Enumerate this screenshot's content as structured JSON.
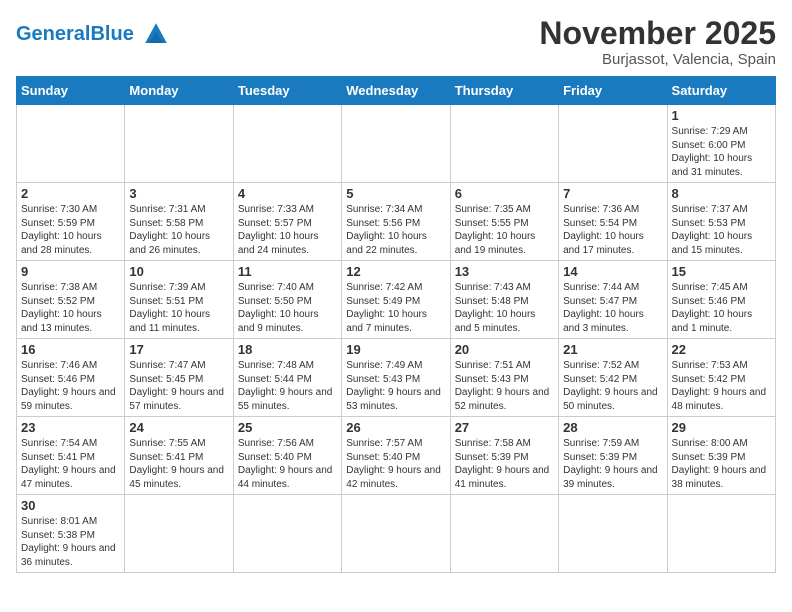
{
  "header": {
    "logo_general": "General",
    "logo_blue": "Blue",
    "month_title": "November 2025",
    "location": "Burjassot, Valencia, Spain"
  },
  "weekdays": [
    "Sunday",
    "Monday",
    "Tuesday",
    "Wednesday",
    "Thursday",
    "Friday",
    "Saturday"
  ],
  "weeks": [
    [
      {
        "day": "",
        "info": ""
      },
      {
        "day": "",
        "info": ""
      },
      {
        "day": "",
        "info": ""
      },
      {
        "day": "",
        "info": ""
      },
      {
        "day": "",
        "info": ""
      },
      {
        "day": "",
        "info": ""
      },
      {
        "day": "1",
        "info": "Sunrise: 7:29 AM\nSunset: 6:00 PM\nDaylight: 10 hours and 31 minutes."
      }
    ],
    [
      {
        "day": "2",
        "info": "Sunrise: 7:30 AM\nSunset: 5:59 PM\nDaylight: 10 hours and 28 minutes."
      },
      {
        "day": "3",
        "info": "Sunrise: 7:31 AM\nSunset: 5:58 PM\nDaylight: 10 hours and 26 minutes."
      },
      {
        "day": "4",
        "info": "Sunrise: 7:33 AM\nSunset: 5:57 PM\nDaylight: 10 hours and 24 minutes."
      },
      {
        "day": "5",
        "info": "Sunrise: 7:34 AM\nSunset: 5:56 PM\nDaylight: 10 hours and 22 minutes."
      },
      {
        "day": "6",
        "info": "Sunrise: 7:35 AM\nSunset: 5:55 PM\nDaylight: 10 hours and 19 minutes."
      },
      {
        "day": "7",
        "info": "Sunrise: 7:36 AM\nSunset: 5:54 PM\nDaylight: 10 hours and 17 minutes."
      },
      {
        "day": "8",
        "info": "Sunrise: 7:37 AM\nSunset: 5:53 PM\nDaylight: 10 hours and 15 minutes."
      }
    ],
    [
      {
        "day": "9",
        "info": "Sunrise: 7:38 AM\nSunset: 5:52 PM\nDaylight: 10 hours and 13 minutes."
      },
      {
        "day": "10",
        "info": "Sunrise: 7:39 AM\nSunset: 5:51 PM\nDaylight: 10 hours and 11 minutes."
      },
      {
        "day": "11",
        "info": "Sunrise: 7:40 AM\nSunset: 5:50 PM\nDaylight: 10 hours and 9 minutes."
      },
      {
        "day": "12",
        "info": "Sunrise: 7:42 AM\nSunset: 5:49 PM\nDaylight: 10 hours and 7 minutes."
      },
      {
        "day": "13",
        "info": "Sunrise: 7:43 AM\nSunset: 5:48 PM\nDaylight: 10 hours and 5 minutes."
      },
      {
        "day": "14",
        "info": "Sunrise: 7:44 AM\nSunset: 5:47 PM\nDaylight: 10 hours and 3 minutes."
      },
      {
        "day": "15",
        "info": "Sunrise: 7:45 AM\nSunset: 5:46 PM\nDaylight: 10 hours and 1 minute."
      }
    ],
    [
      {
        "day": "16",
        "info": "Sunrise: 7:46 AM\nSunset: 5:46 PM\nDaylight: 9 hours and 59 minutes."
      },
      {
        "day": "17",
        "info": "Sunrise: 7:47 AM\nSunset: 5:45 PM\nDaylight: 9 hours and 57 minutes."
      },
      {
        "day": "18",
        "info": "Sunrise: 7:48 AM\nSunset: 5:44 PM\nDaylight: 9 hours and 55 minutes."
      },
      {
        "day": "19",
        "info": "Sunrise: 7:49 AM\nSunset: 5:43 PM\nDaylight: 9 hours and 53 minutes."
      },
      {
        "day": "20",
        "info": "Sunrise: 7:51 AM\nSunset: 5:43 PM\nDaylight: 9 hours and 52 minutes."
      },
      {
        "day": "21",
        "info": "Sunrise: 7:52 AM\nSunset: 5:42 PM\nDaylight: 9 hours and 50 minutes."
      },
      {
        "day": "22",
        "info": "Sunrise: 7:53 AM\nSunset: 5:42 PM\nDaylight: 9 hours and 48 minutes."
      }
    ],
    [
      {
        "day": "23",
        "info": "Sunrise: 7:54 AM\nSunset: 5:41 PM\nDaylight: 9 hours and 47 minutes."
      },
      {
        "day": "24",
        "info": "Sunrise: 7:55 AM\nSunset: 5:41 PM\nDaylight: 9 hours and 45 minutes."
      },
      {
        "day": "25",
        "info": "Sunrise: 7:56 AM\nSunset: 5:40 PM\nDaylight: 9 hours and 44 minutes."
      },
      {
        "day": "26",
        "info": "Sunrise: 7:57 AM\nSunset: 5:40 PM\nDaylight: 9 hours and 42 minutes."
      },
      {
        "day": "27",
        "info": "Sunrise: 7:58 AM\nSunset: 5:39 PM\nDaylight: 9 hours and 41 minutes."
      },
      {
        "day": "28",
        "info": "Sunrise: 7:59 AM\nSunset: 5:39 PM\nDaylight: 9 hours and 39 minutes."
      },
      {
        "day": "29",
        "info": "Sunrise: 8:00 AM\nSunset: 5:39 PM\nDaylight: 9 hours and 38 minutes."
      }
    ],
    [
      {
        "day": "30",
        "info": "Sunrise: 8:01 AM\nSunset: 5:38 PM\nDaylight: 9 hours and 36 minutes."
      },
      {
        "day": "",
        "info": ""
      },
      {
        "day": "",
        "info": ""
      },
      {
        "day": "",
        "info": ""
      },
      {
        "day": "",
        "info": ""
      },
      {
        "day": "",
        "info": ""
      },
      {
        "day": "",
        "info": ""
      }
    ]
  ]
}
